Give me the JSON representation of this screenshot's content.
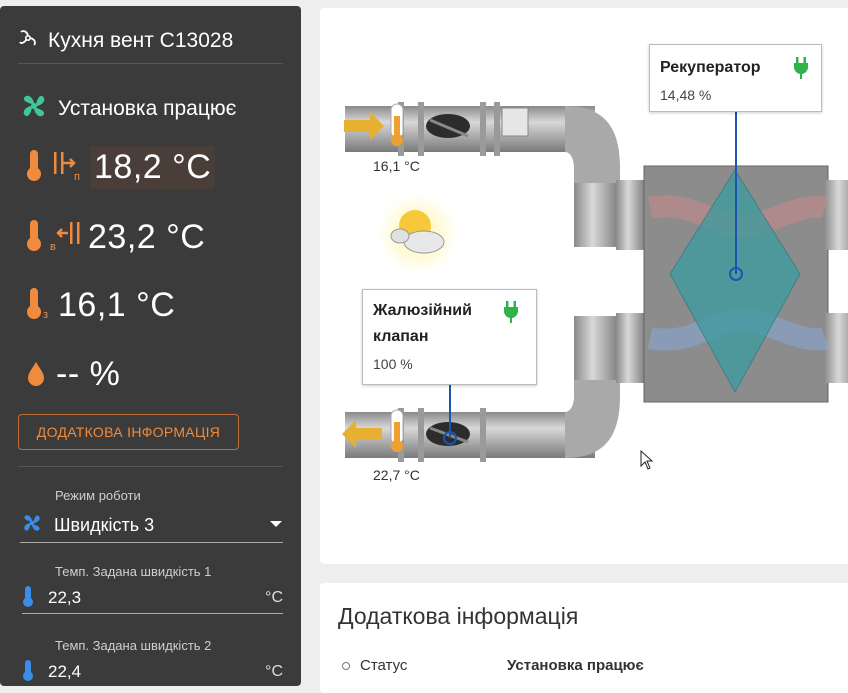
{
  "device": {
    "title": "Кухня вент C13028",
    "status": "Установка працює"
  },
  "sensors": [
    {
      "name": "supply",
      "sub": "п",
      "value": "18,2 °C"
    },
    {
      "name": "extract",
      "sub": "в",
      "value": "23,2 °C"
    },
    {
      "name": "outdoor",
      "sub": "з",
      "value": "16,1 °C"
    },
    {
      "name": "humidity",
      "value": "-- %"
    }
  ],
  "info_button": "ДОДАТКОВА ІНФОРМАЦІЯ",
  "mode": {
    "label": "Режим роботи",
    "value": "Швидкість 3"
  },
  "fields": [
    {
      "label": "Темп. Задана швидкість 1",
      "value": "22,3",
      "unit": "°C"
    },
    {
      "label": "Темп. Задана швидкість 2",
      "value": "22,4",
      "unit": "°C"
    }
  ],
  "diagram": {
    "recuperator": {
      "title": "Рекуператор",
      "value": "14,48 %"
    },
    "damper": {
      "title_line1": "Жалюзійний",
      "title_line2": "клапан",
      "value": "100 %"
    },
    "inlet_temp": "16,1 °C",
    "outlet_temp": "22,7 °C"
  },
  "info_card": {
    "title": "Додаткова інформація",
    "status_label": "Статус",
    "status_value": "Установка працює"
  },
  "colors": {
    "accent": "#f08a3c",
    "fan": "#3fc79a",
    "plug": "#2fb34a",
    "blue": "#1a56b0",
    "panel": "#3b3b3b"
  }
}
